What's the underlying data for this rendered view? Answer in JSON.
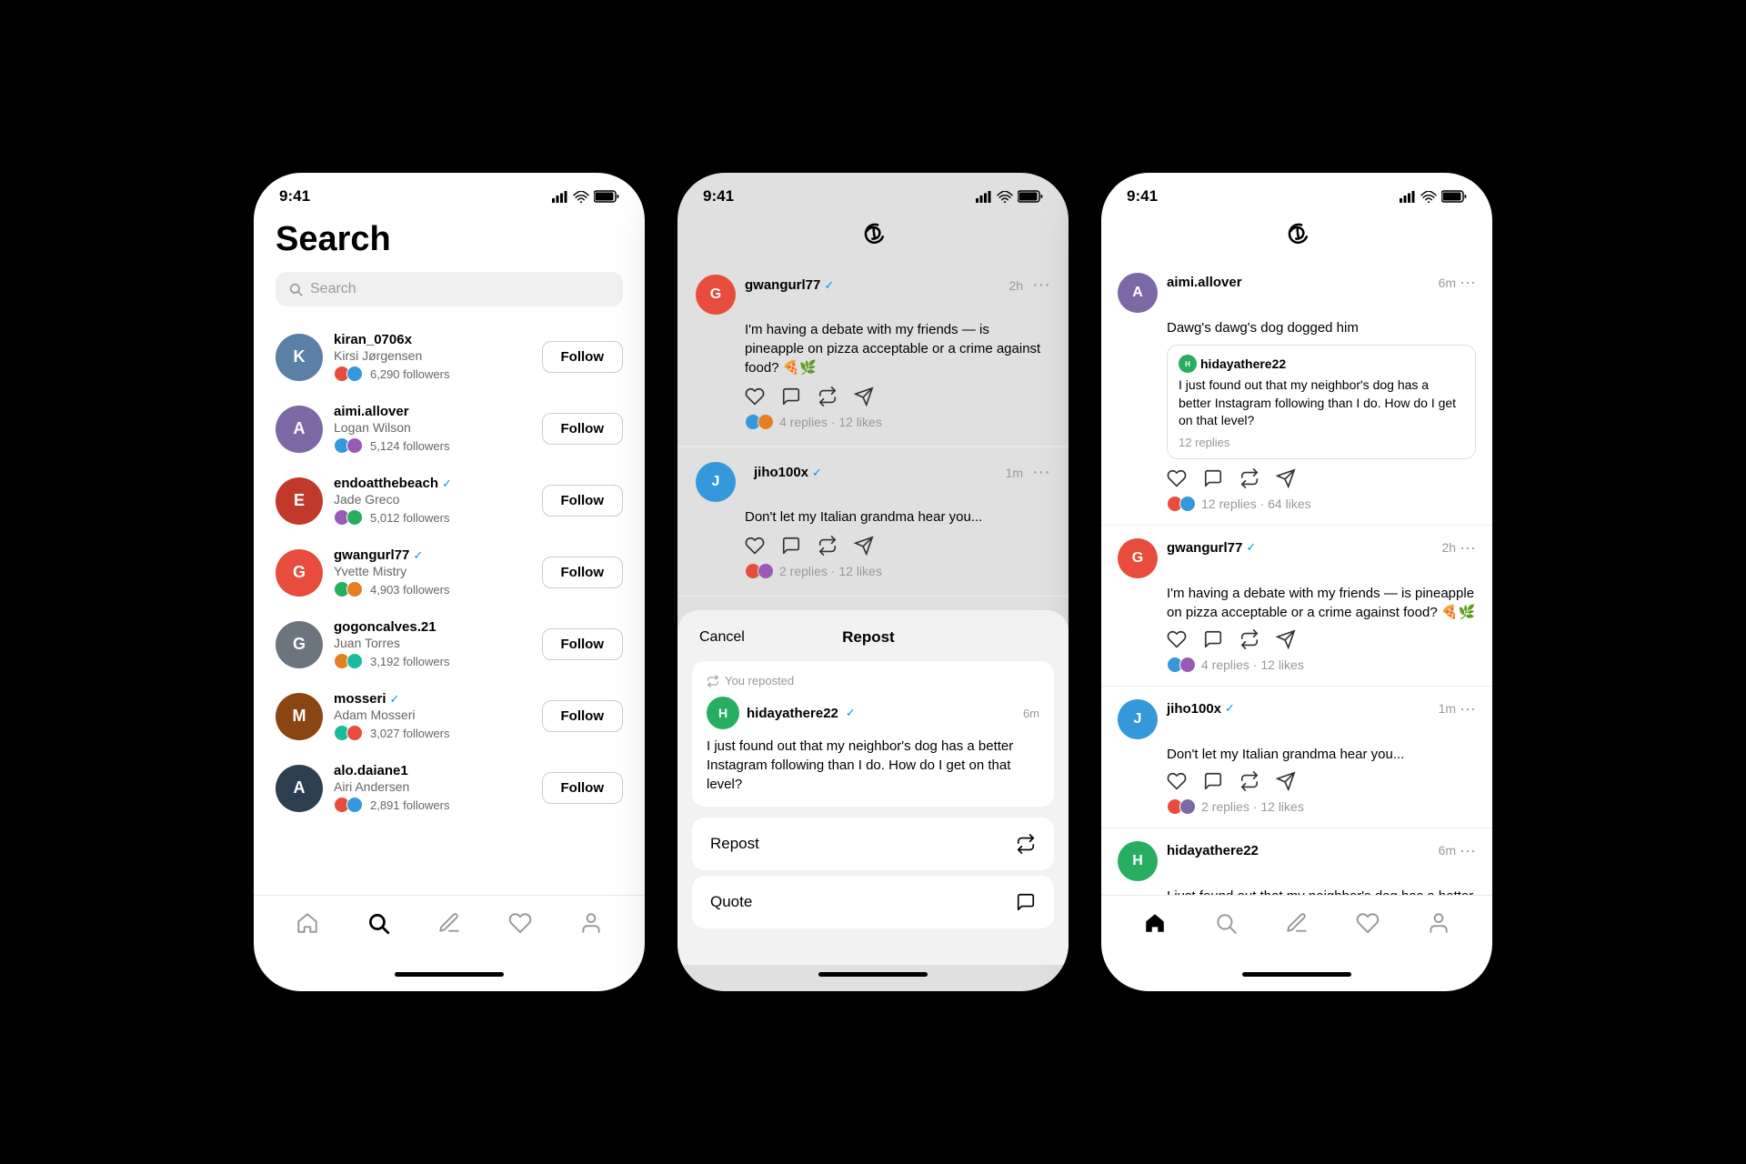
{
  "phones": {
    "phone1": {
      "status_time": "9:41",
      "title": "Search",
      "search_placeholder": "Search",
      "users": [
        {
          "username": "kiran_0706x",
          "real_name": "Kirsi Jørgensen",
          "followers": "6,290 followers",
          "verified": false,
          "color": "#5b7fa6",
          "initials": "K"
        },
        {
          "username": "aimi.allover",
          "real_name": "Logan Wilson",
          "followers": "5,124 followers",
          "verified": false,
          "color": "#7b68a4",
          "initials": "A"
        },
        {
          "username": "endoatthebeach",
          "real_name": "Jade Greco",
          "followers": "5,012 followers",
          "verified": true,
          "color": "#c0392b",
          "initials": "E"
        },
        {
          "username": "gwangurl77",
          "real_name": "Yvette Mistry",
          "followers": "4,903 followers",
          "verified": true,
          "color": "#e74c3c",
          "initials": "G"
        },
        {
          "username": "gogoncalves.21",
          "real_name": "Juan Torres",
          "followers": "3,192 followers",
          "verified": false,
          "color": "#6c757d",
          "initials": "G"
        },
        {
          "username": "mosseri",
          "real_name": "Adam Mosseri",
          "followers": "3,027 followers",
          "verified": true,
          "color": "#8b4513",
          "initials": "M"
        },
        {
          "username": "alo.daiane1",
          "real_name": "Airi Andersen",
          "followers": "2,891 followers",
          "verified": false,
          "color": "#2c3e50",
          "initials": "A"
        }
      ],
      "follow_label": "Follow",
      "nav": [
        "home",
        "search",
        "compose",
        "heart",
        "person"
      ]
    },
    "phone2": {
      "status_time": "9:41",
      "posts": [
        {
          "username": "gwangurl77",
          "verified": true,
          "time": "2h",
          "text": "I'm having a debate with my friends — is pineapple on pizza acceptable or a crime against food? 🍕🌿",
          "replies": "4 replies",
          "likes": "12 likes",
          "color": "#e74c3c",
          "initials": "G"
        },
        {
          "username": "jiho100x",
          "verified": true,
          "time": "1m",
          "text": "Don't let my Italian grandma hear you...",
          "replies": "2 replies",
          "likes": "12 likes",
          "color": "#3498db",
          "initials": "J"
        },
        {
          "username": "hidayathere22",
          "verified": false,
          "time": "6m",
          "text": "I just found out that my neighbor's dog has a",
          "replies": "",
          "likes": "",
          "color": "#27ae60",
          "initials": "H"
        }
      ],
      "modal": {
        "cancel_label": "Cancel",
        "title_label": "Repost",
        "you_reposted": "You reposted",
        "post_username": "hidayathere22",
        "post_verified": true,
        "post_time": "6m",
        "post_text": "I just found out that my neighbor's dog has a better Instagram following than I do. How do I get on that level?",
        "repost_label": "Repost",
        "quote_label": "Quote",
        "post_color": "#27ae60",
        "post_initials": "H"
      }
    },
    "phone3": {
      "status_time": "9:41",
      "posts": [
        {
          "username": "aimi.allover",
          "verified": false,
          "time": "6m",
          "text": "Dawg's dawg's dog dogged him",
          "has_quote": true,
          "quote_username": "hidayathere22",
          "quote_text": "I just found out that my neighbor's dog has a better Instagram following than I do. How do I get on that level?",
          "quote_replies": "12 replies",
          "replies": "12 replies",
          "likes": "64 likes",
          "color": "#7b68a4",
          "initials": "A"
        },
        {
          "username": "gwangurl77",
          "verified": true,
          "time": "2h",
          "text": "I'm having a debate with my friends — is pineapple on pizza acceptable or a crime against food? 🍕🌿",
          "replies": "4 replies",
          "likes": "12 likes",
          "color": "#e74c3c",
          "initials": "G",
          "has_quote": false
        },
        {
          "username": "jiho100x",
          "verified": true,
          "time": "1m",
          "text": "Don't let my Italian grandma hear you...",
          "replies": "2 replies",
          "likes": "12 likes",
          "color": "#3498db",
          "initials": "J",
          "has_quote": false
        },
        {
          "username": "hidayathere22",
          "verified": false,
          "time": "6m",
          "text": "I just found out that my neighbor's dog has a better Instagram following than I do. How do",
          "replies": "",
          "likes": "",
          "color": "#27ae60",
          "initials": "H",
          "has_quote": false
        }
      ],
      "nav": [
        "home",
        "search",
        "compose",
        "heart",
        "person"
      ]
    }
  }
}
